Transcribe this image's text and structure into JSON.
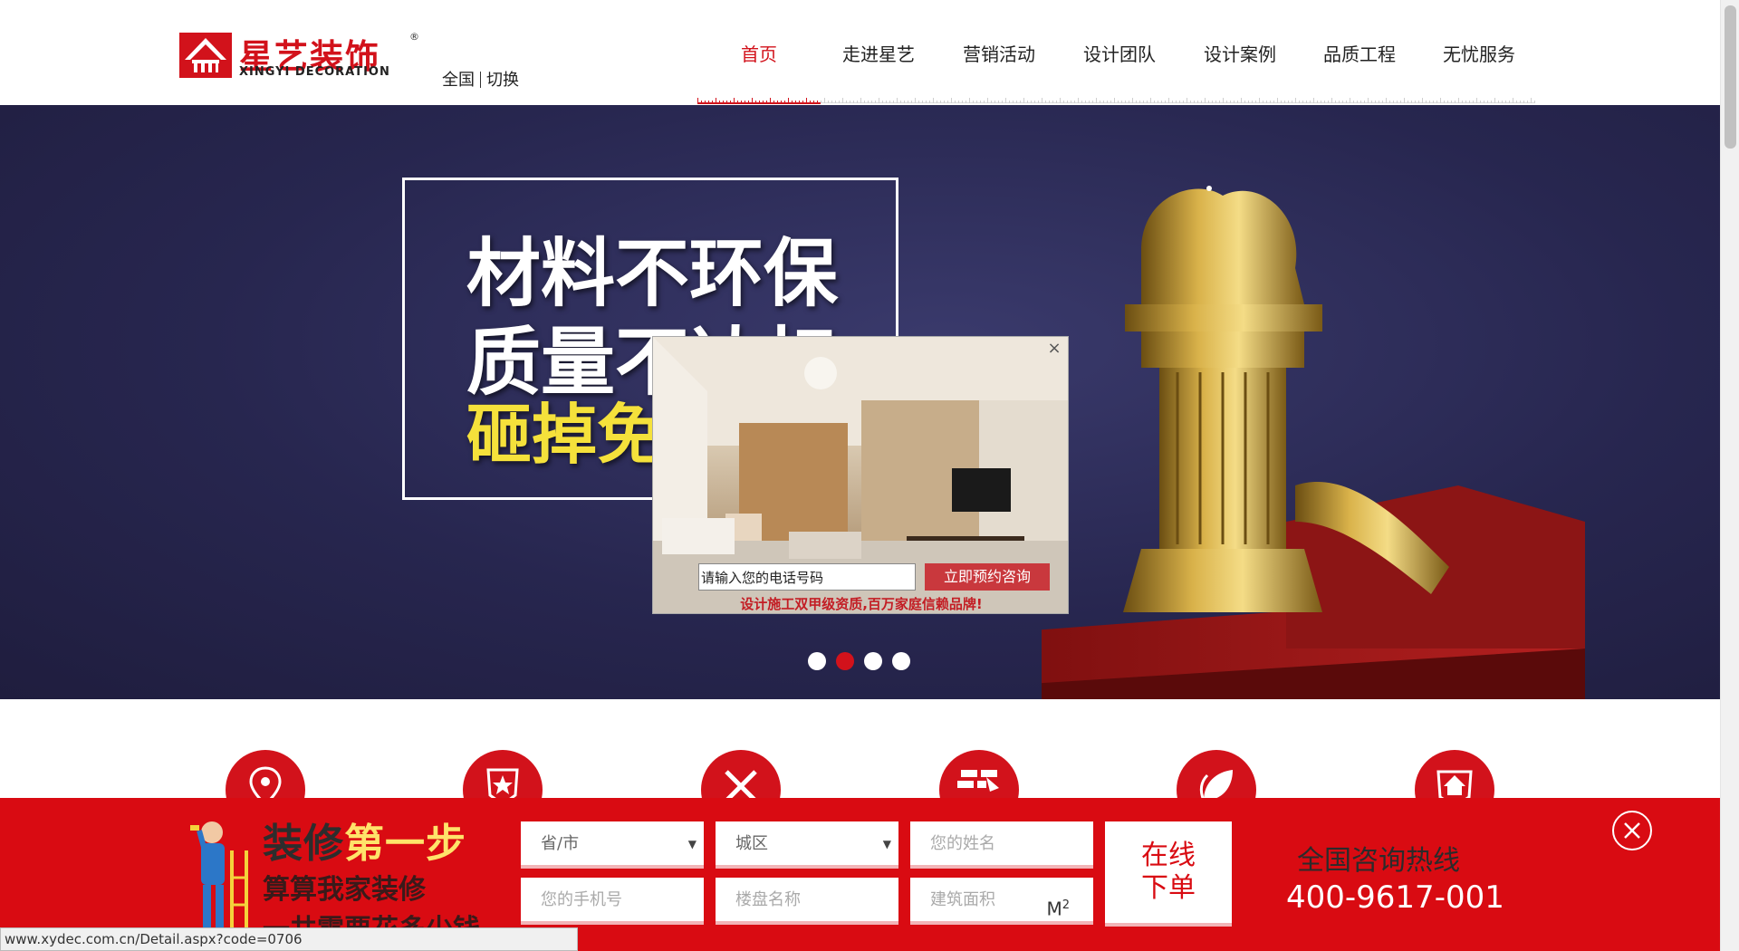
{
  "header": {
    "logo_cn": "星艺装饰",
    "logo_en": "XINGYI DECORATION",
    "logo_reg": "®",
    "region": "全国",
    "switch_label": "切换"
  },
  "nav": [
    {
      "label": "首页",
      "active": true
    },
    {
      "label": "走进星艺"
    },
    {
      "label": "营销活动"
    },
    {
      "label": "设计团队"
    },
    {
      "label": "设计案例"
    },
    {
      "label": "品质工程"
    },
    {
      "label": "无忧服务"
    }
  ],
  "banner": {
    "line1": "材料不环保",
    "line2": "质量不达标",
    "line3": "砸掉免",
    "active_slide": 2,
    "slide_count": 4
  },
  "popup": {
    "close": "×",
    "phone_value": "请输入您的电话号码",
    "button": "立即预约咨询",
    "tagline": "设计施工双甲级资质,百万家庭信赖品牌!"
  },
  "feature_icons": [
    "location-pin-icon",
    "shield-star-icon",
    "pencil-ruler-icon",
    "brick-wall-icon",
    "leaf-icon",
    "house-shield-icon"
  ],
  "bottom_bar": {
    "title_a": "装修",
    "title_b": "第一步",
    "subtitle": "算算我家装修",
    "subtitle2": "一共需要花多少钱",
    "province": "省/市",
    "district": "城区",
    "name_placeholder": "您的姓名",
    "phone_placeholder": "您的手机号",
    "estate_placeholder": "楼盘名称",
    "area_placeholder": "建筑面积",
    "area_unit": "M",
    "area_unit_sup": "2",
    "submit_line1": "在线",
    "submit_line2": "下单",
    "hotline_label": "全国咨询热线",
    "hotline_number": "400-9617-001"
  },
  "status_url": "www.xydec.com.cn/Detail.aspx?code=0706",
  "colors": {
    "brand_red": "#d2121b",
    "banner_navy": "#27264f",
    "bar_red": "#d90b12",
    "slogan_yellow": "#f5e13b"
  }
}
